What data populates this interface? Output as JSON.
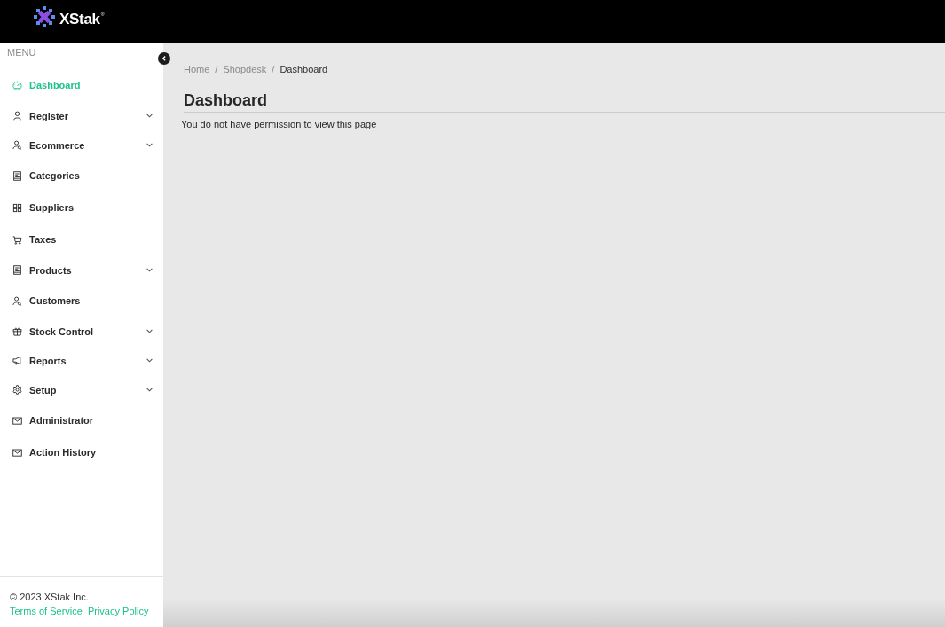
{
  "header": {
    "brand": "XStak$^{®}$"
  },
  "sidebar": {
    "heading": "MENU",
    "items": [
      {
        "label": "Dashboard",
        "kind": "link",
        "selected": true
      },
      {
        "label": "Register",
        "kind": "group",
        "selected": false,
        "expanded": false
      },
      {
        "label": "Ecommerce",
        "kind": "group",
        "selected": false,
        "expanded": false
      },
      {
        "label": "Categories",
        "kind": "link",
        "selected": false
      },
      {
        "label": "Suppliers",
        "kind": "link",
        "selected": false
      },
      {
        "label": "Taxes",
        "kind": "link",
        "selected": false
      },
      {
        "label": "Products",
        "kind": "group",
        "selected": false,
        "expanded": false
      },
      {
        "label": "Customers",
        "kind": "link",
        "selected": false
      },
      {
        "label": "Stock Control",
        "kind": "group",
        "selected": false,
        "expanded": false
      },
      {
        "label": "Reports",
        "kind": "group",
        "selected": false,
        "expanded": false
      },
      {
        "label": "Setup",
        "kind": "group",
        "selected": false,
        "expanded": false
      },
      {
        "label": "Administrator",
        "kind": "link",
        "selected": false
      },
      {
        "label": "Action History",
        "kind": "link",
        "selected": false
      }
    ],
    "footer": {
      "copyright": "© 2023 XStak Inc.",
      "links": [
        "Terms of Service",
        "Privacy Policy"
      ]
    }
  },
  "breadcrumb": {
    "items": [
      {
        "label": "Home",
        "current": false
      },
      {
        "label": "Shopdesk",
        "current": false
      },
      {
        "label": "Dashboard",
        "current": true
      }
    ],
    "separators": [
      "/",
      "/"
    ]
  },
  "page": {
    "title": "Dashboard",
    "message": "You do not have permission to view this page"
  }
}
